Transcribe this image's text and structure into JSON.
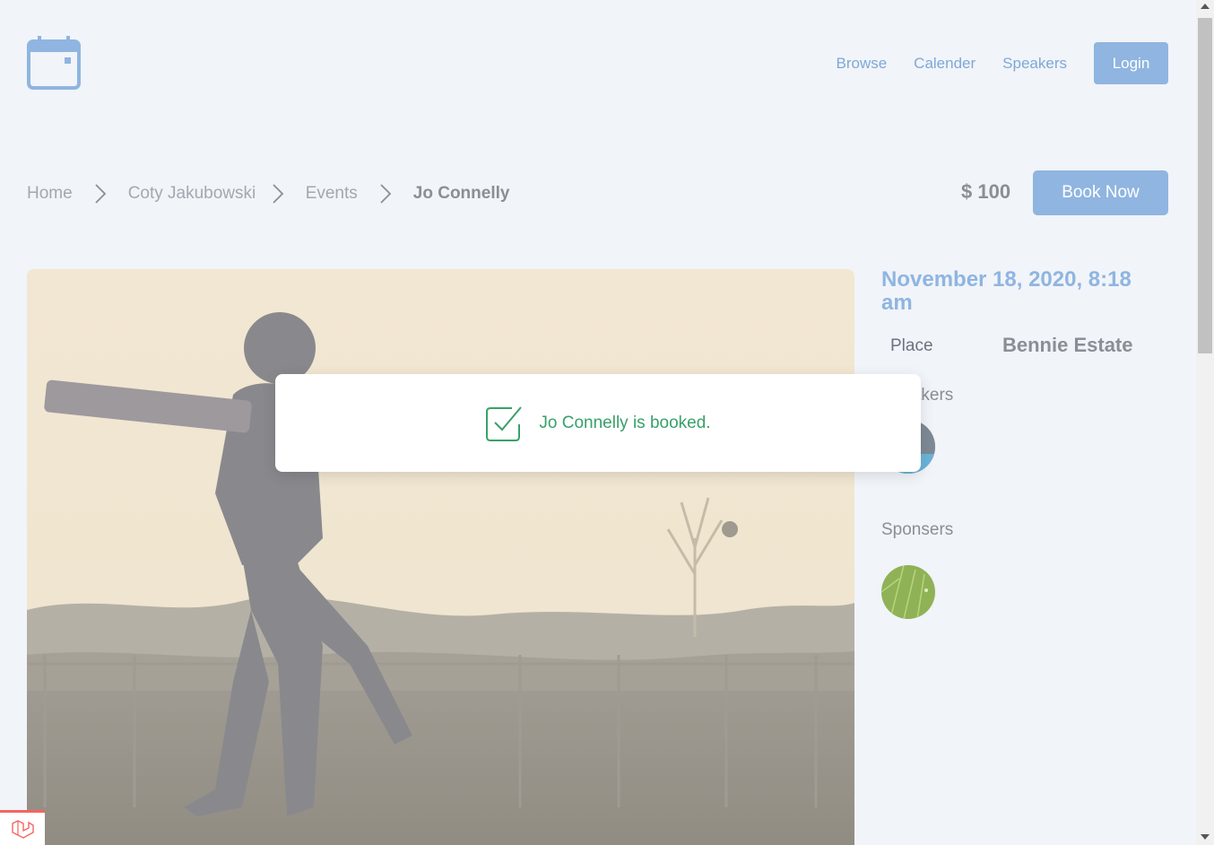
{
  "header": {
    "logo_icon": "calendar-icon",
    "nav": [
      {
        "label": "Browse"
      },
      {
        "label": "Calender"
      },
      {
        "label": "Speakers"
      }
    ],
    "login_label": "Login"
  },
  "breadcrumb": {
    "items": [
      "Home",
      "Coty Jakubowski I",
      "Events"
    ],
    "current": "Jo Connelly"
  },
  "event": {
    "price": "$ 100",
    "book_label": "Book Now",
    "date": "November 18, 2020, 8:18 am",
    "place_label": "Place",
    "place_value": "Bennie Estate",
    "speakers_label": "Speakers",
    "sponsers_label": "Sponsers"
  },
  "toast": {
    "message": "Jo Connelly is booked.",
    "icon": "check-square-icon"
  },
  "colors": {
    "accent": "#8fb5e0",
    "success": "#38a169",
    "background": "#f1f4f9"
  }
}
